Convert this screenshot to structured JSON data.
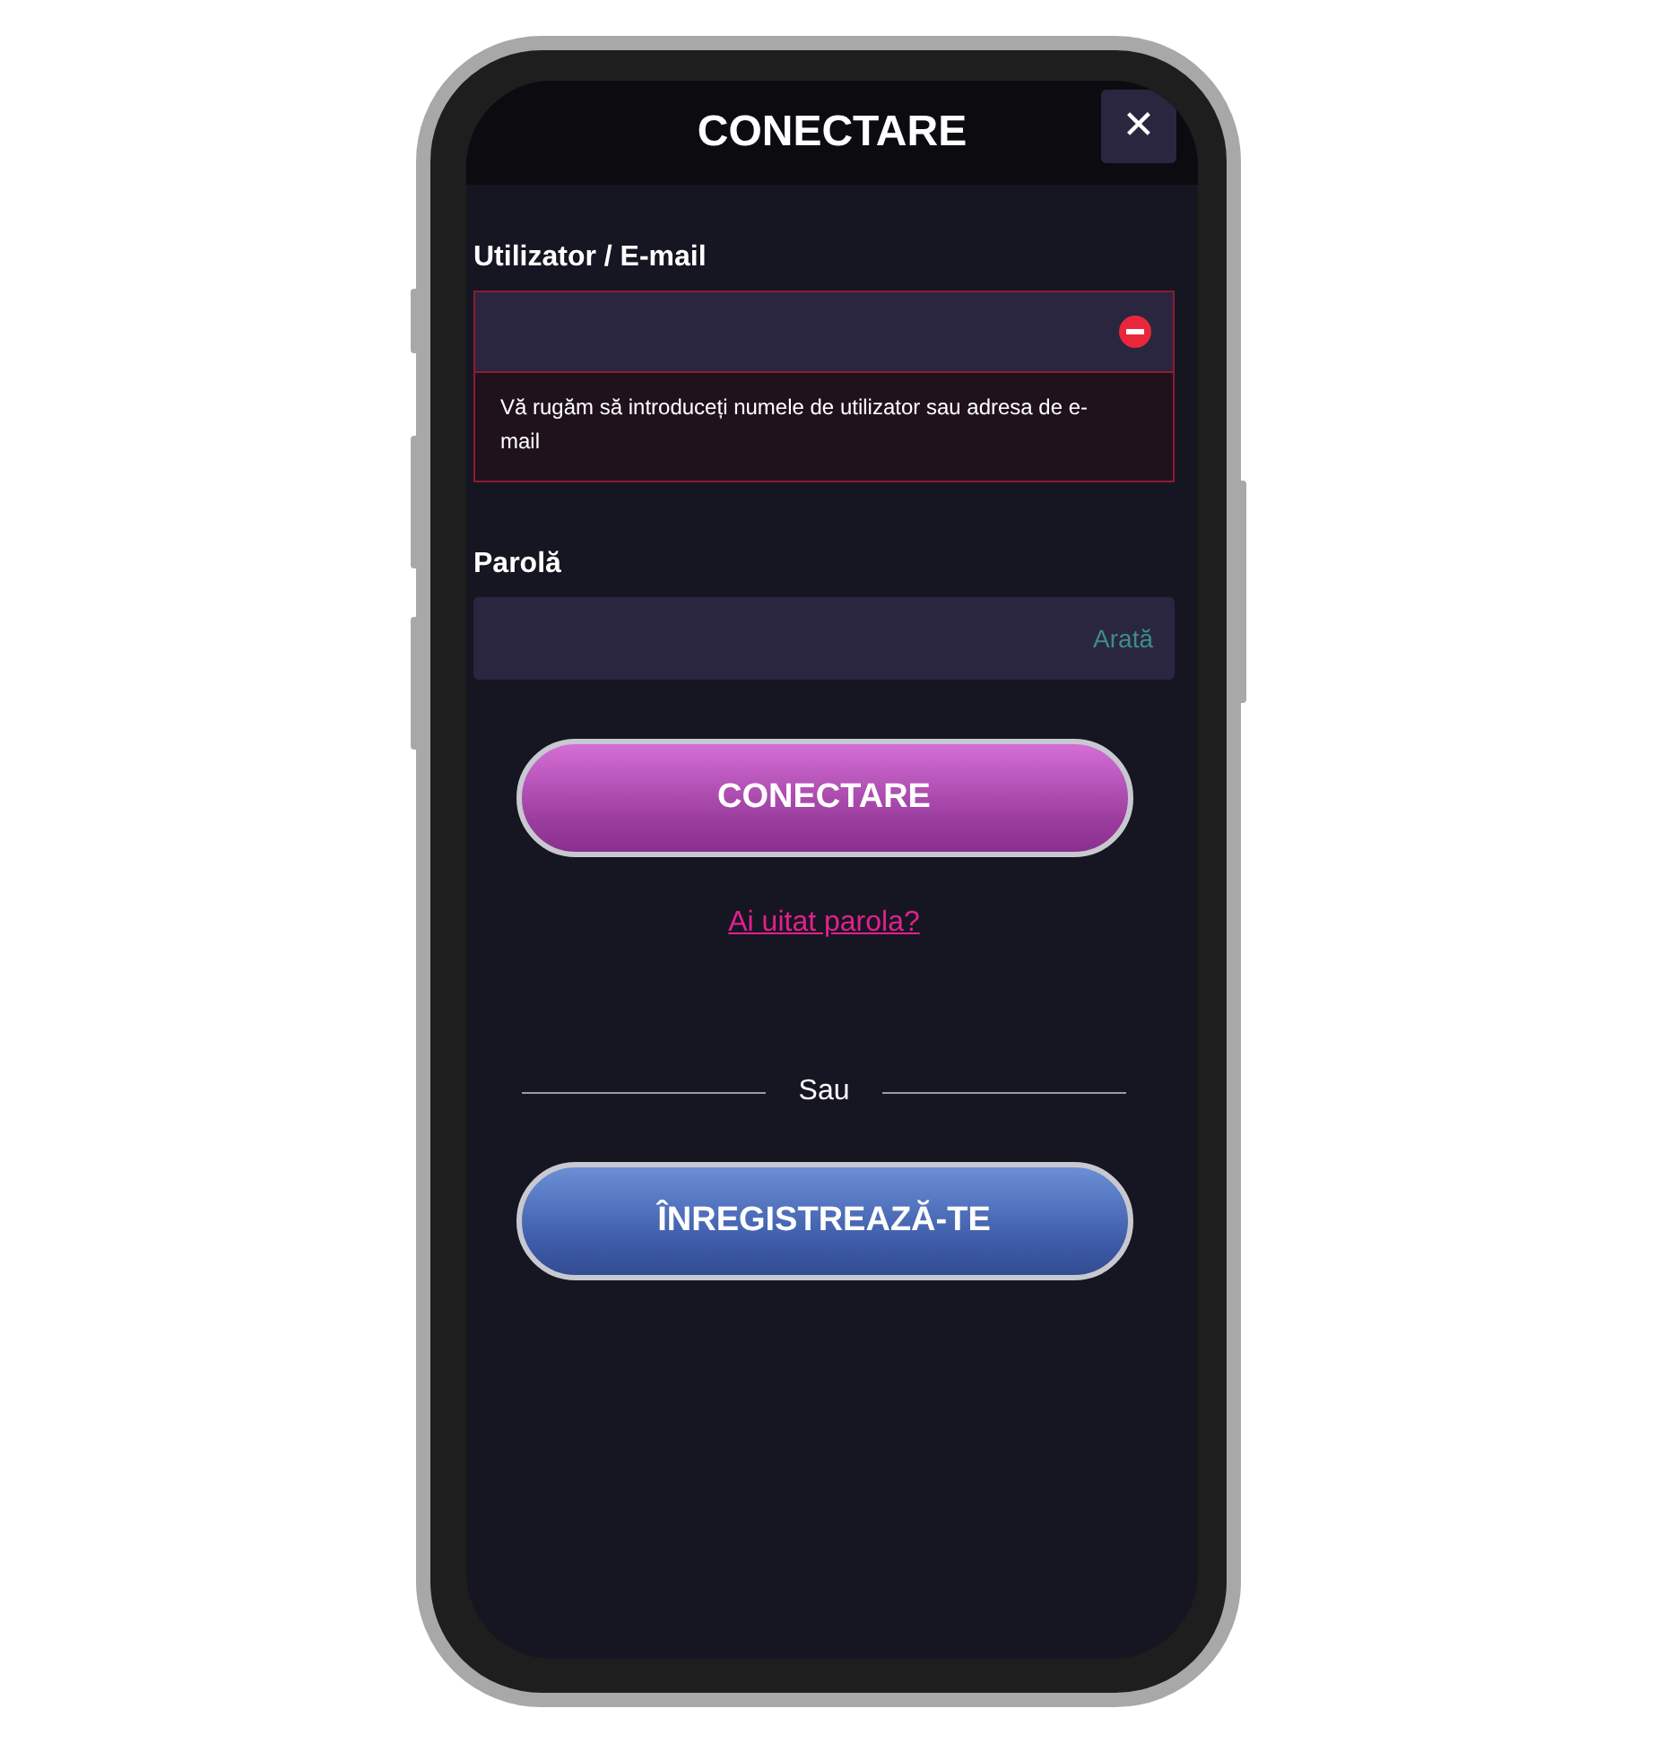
{
  "header": {
    "title": "CONECTARE",
    "close": "✕"
  },
  "fields": [
    {
      "label": "Utilizator / E-mail",
      "invalid": true,
      "error": "Vă rugăm să introduceți numele de utilizator sau adresa de e-mail"
    },
    {
      "label": "Parolă",
      "invalid": false,
      "toggle": "Arată"
    }
  ],
  "login_button": "CONECTARE",
  "forgot_link": "Ai uitat parola?",
  "divider_text": "Sau",
  "register_button": "ÎNREGISTREAZĂ-TE"
}
